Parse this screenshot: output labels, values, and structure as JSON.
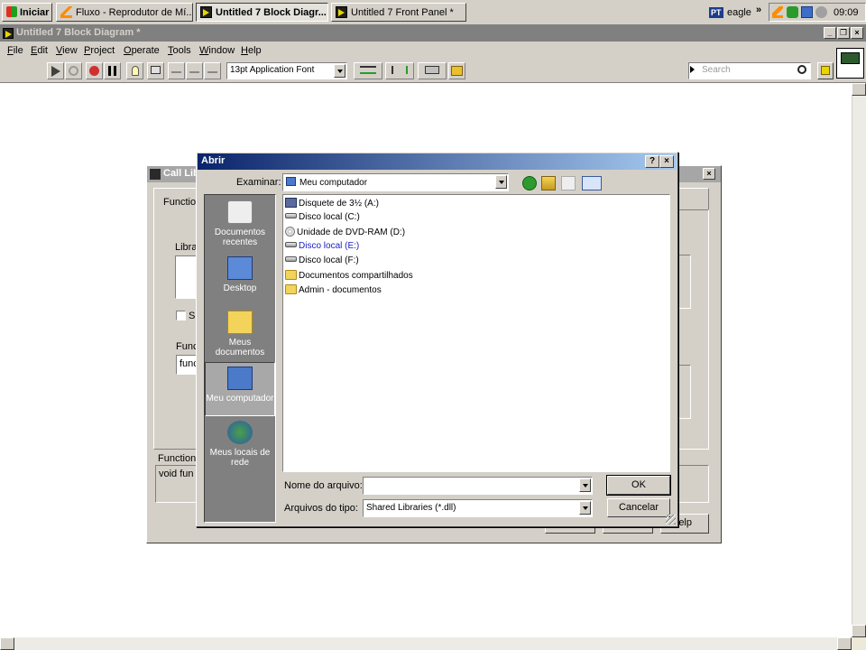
{
  "taskbar": {
    "start_label": "Iniciar",
    "tasks": [
      {
        "label": "Fluxo - Reprodutor de Mí...",
        "icon": "vlc-cone-icon",
        "active": false
      },
      {
        "label": "Untitled 7 Block Diagr...",
        "icon": "labview-icon",
        "active": true
      },
      {
        "label": "Untitled 7 Front Panel *",
        "icon": "labview-icon",
        "active": false
      }
    ],
    "lang": "PT",
    "user": "eagle",
    "chevron": "»",
    "clock": "09:09"
  },
  "window": {
    "title": "Untitled 7 Block Diagram *",
    "menus": [
      {
        "ul": "F",
        "rest": "ile"
      },
      {
        "ul": "E",
        "rest": "dit"
      },
      {
        "ul": "V",
        "rest": "iew"
      },
      {
        "ul": "P",
        "rest": "roject"
      },
      {
        "ul": "O",
        "rest": "perate"
      },
      {
        "ul": "T",
        "rest": "ools"
      },
      {
        "ul": "W",
        "rest": "indow"
      },
      {
        "ul": "H",
        "rest": "elp"
      }
    ],
    "font_select": "13pt Application Font",
    "search_placeholder": "Search"
  },
  "clf_dialog": {
    "title": "Call Library Function",
    "tab_function": "Function",
    "library_label": "Libra",
    "checkbox_label": "Sp",
    "function_label": "Func",
    "function_value": "func",
    "prototype_label": "Function",
    "prototype_value": "void  fun",
    "help_label": "elp"
  },
  "open_dialog": {
    "title": "Abrir",
    "help_btn": "?",
    "close_btn": "×",
    "look_in_label": "Examinar:",
    "look_in_value": "Meu computador",
    "places": [
      {
        "label": "Documentos recentes",
        "icon": "recent-documents-icon"
      },
      {
        "label": "Desktop",
        "icon": "desktop-icon"
      },
      {
        "label": "Meus documentos",
        "icon": "my-documents-icon"
      },
      {
        "label": "Meu computador",
        "icon": "my-computer-icon"
      },
      {
        "label": "Meus locais de rede",
        "icon": "network-places-icon"
      }
    ],
    "files": [
      {
        "name": "Disquete de 3½ (A:)",
        "type": "floppy"
      },
      {
        "name": "Disco local (C:)",
        "type": "drive"
      },
      {
        "name": "Unidade de DVD-RAM (D:)",
        "type": "cdrom"
      },
      {
        "name": "Disco local (E:)",
        "type": "drive",
        "highlight": true
      },
      {
        "name": "Disco local (F:)",
        "type": "drive"
      },
      {
        "name": "Documentos compartilhados",
        "type": "folder"
      },
      {
        "name": "Admin - documentos",
        "type": "folder"
      }
    ],
    "filename_label": "Nome do arquivo:",
    "filename_value": "",
    "filetype_label": "Arquivos do tipo:",
    "filetype_value": "Shared Libraries (*.dll)",
    "ok_label": "OK",
    "cancel_label": "Cancelar"
  }
}
